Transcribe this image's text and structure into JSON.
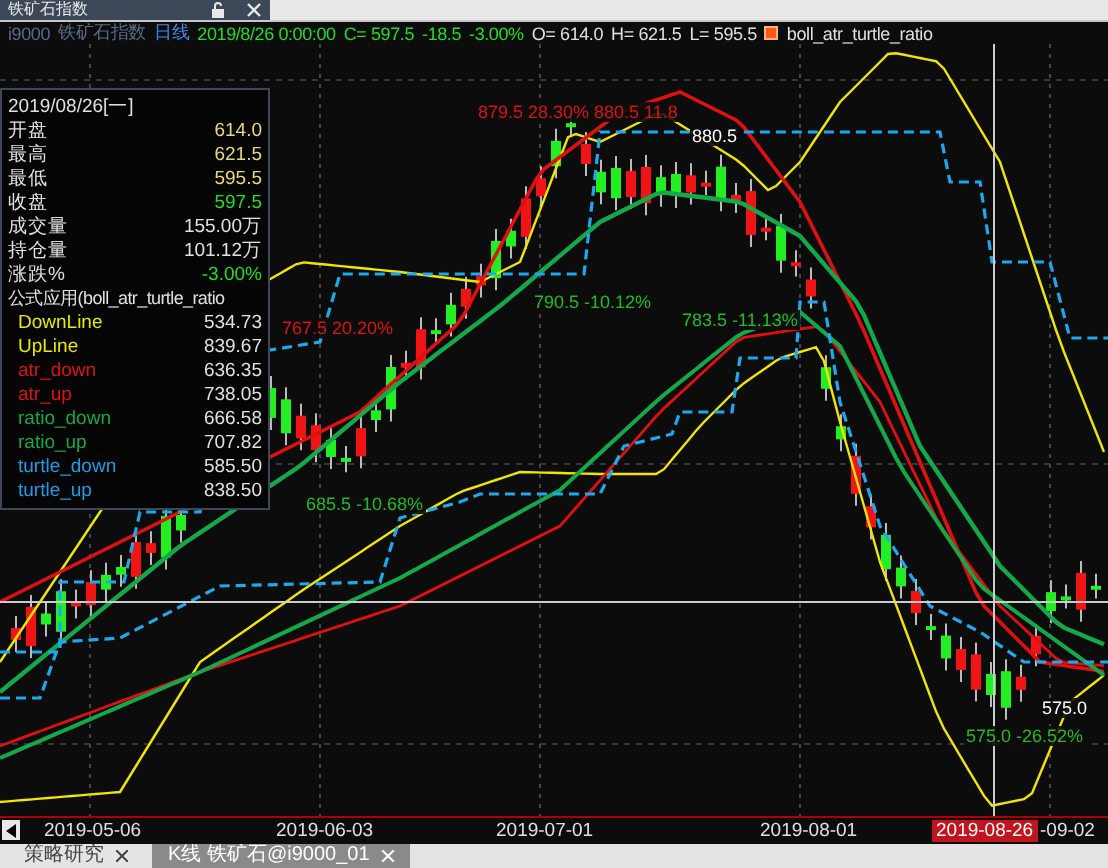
{
  "window": {
    "title": "铁矿石指数"
  },
  "header": {
    "symbol": "i9000",
    "name": "铁矿石指数",
    "period": "日线",
    "datetime": "2019/8/26 0:00:00",
    "close": "C= 597.5",
    "change": "-18.5",
    "change_pct": "-3.00%",
    "open": "O= 614.0",
    "high": "H= 621.5",
    "low": "L= 595.5",
    "indicator": "boll_atr_turtle_ratio"
  },
  "info_panel": {
    "date": "2019/08/26[一]",
    "quotes": [
      {
        "label": "开盘",
        "value": "614.0",
        "color": "#e8d87a"
      },
      {
        "label": "最高",
        "value": "621.5",
        "color": "#e8d87a"
      },
      {
        "label": "最低",
        "value": "595.5",
        "color": "#e8d87a"
      },
      {
        "label": "收盘",
        "value": "597.5",
        "color": "#22dd22"
      },
      {
        "label": "成交量",
        "value": "155.00万",
        "color": "#e0e0e0"
      },
      {
        "label": "持仓量",
        "value": "101.12万",
        "color": "#e0e0e0"
      },
      {
        "label": "涨跌%",
        "value": "-3.00%",
        "color": "#22dd22"
      }
    ],
    "formula": "公式应用(boll_atr_turtle_ratio",
    "indicators": [
      {
        "label": "DownLine",
        "value": "534.73",
        "color": "#e8e800"
      },
      {
        "label": "UpLine",
        "value": "839.67",
        "color": "#e8e800"
      },
      {
        "label": "atr_down",
        "value": "636.35",
        "color": "#dd1111"
      },
      {
        "label": "atr_up",
        "value": "738.05",
        "color": "#dd1111"
      },
      {
        "label": "ratio_down",
        "value": "666.58",
        "color": "#11aa44"
      },
      {
        "label": "ratio_up",
        "value": "707.82",
        "color": "#11aa44"
      },
      {
        "label": "turtle_down",
        "value": "585.50",
        "color": "#1a9ee8"
      },
      {
        "label": "turtle_up",
        "value": "838.50",
        "color": "#1a9ee8"
      }
    ]
  },
  "chart": {
    "annotations": [
      {
        "text": "879.5 28.30%",
        "color": "#dd1111"
      },
      {
        "text": "880.5 11.8",
        "color": "#dd1111"
      },
      {
        "text": "880.5",
        "color": "#ffffff"
      },
      {
        "text": "767.5 20.20%",
        "color": "#dd1111"
      },
      {
        "text": "790.5 -10.12%",
        "color": "#22bb22"
      },
      {
        "text": "783.5 -11.13%",
        "color": "#22bb22"
      },
      {
        "text": "685.5 -10.68%",
        "color": "#22bb22"
      },
      {
        "text": "575.0 -26.52%",
        "color": "#22bb22"
      },
      {
        "text": "575.0",
        "color": "#ffffff"
      }
    ]
  },
  "x_axis": {
    "labels": [
      {
        "text": "2019-05-06",
        "selected": false
      },
      {
        "text": "2019-06-03",
        "selected": false
      },
      {
        "text": "2019-07-01",
        "selected": false
      },
      {
        "text": "2019-08-01",
        "selected": false
      },
      {
        "text": "2019-08-26",
        "selected": true
      },
      {
        "text": "-09-02",
        "selected": false
      }
    ]
  },
  "tabs": [
    {
      "label": "策略研究",
      "selected": false
    },
    {
      "label": "K线 铁矿石@i9000_01",
      "selected": true
    }
  ]
}
